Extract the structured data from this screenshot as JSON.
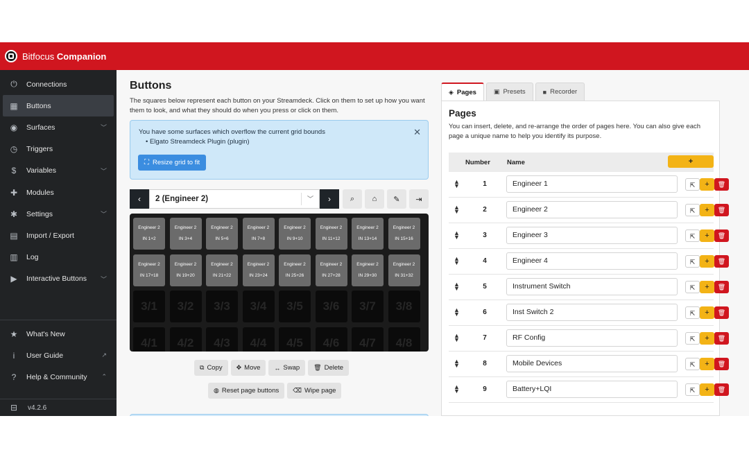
{
  "brand": {
    "name_light": "Bitfocus",
    "name_bold": "Companion"
  },
  "nav": [
    {
      "label": "Connections",
      "icon": "plug-icon",
      "glyph": "⏻",
      "chevron": false,
      "active": false
    },
    {
      "label": "Buttons",
      "icon": "grid-icon",
      "glyph": "▦",
      "chevron": false,
      "active": true
    },
    {
      "label": "Surfaces",
      "icon": "gamepad-icon",
      "glyph": "◉",
      "chevron": true,
      "active": false
    },
    {
      "label": "Triggers",
      "icon": "clock-icon",
      "glyph": "◷",
      "chevron": false,
      "active": false
    },
    {
      "label": "Variables",
      "icon": "dollar-icon",
      "glyph": "$",
      "chevron": true,
      "active": false
    },
    {
      "label": "Modules",
      "icon": "puzzle-icon",
      "glyph": "✚",
      "chevron": false,
      "active": false
    },
    {
      "label": "Settings",
      "icon": "gear-icon",
      "glyph": "✱",
      "chevron": true,
      "active": false
    },
    {
      "label": "Import / Export",
      "icon": "file-export-icon",
      "glyph": "▤",
      "chevron": false,
      "active": false
    },
    {
      "label": "Log",
      "icon": "log-icon",
      "glyph": "▥",
      "chevron": false,
      "active": false
    },
    {
      "label": "Interactive Buttons",
      "icon": "square-caret-icon",
      "glyph": "▶",
      "chevron": true,
      "active": false
    }
  ],
  "nav_bottom": [
    {
      "label": "What's New",
      "icon": "star-icon",
      "glyph": "★",
      "chevron": ""
    },
    {
      "label": "User Guide",
      "icon": "info-icon",
      "glyph": "i",
      "chevron": "↗"
    },
    {
      "label": "Help & Community",
      "icon": "question-icon",
      "glyph": "?",
      "chevron": "⌃"
    }
  ],
  "version": "v4.2.6",
  "buttons_panel": {
    "title": "Buttons",
    "description": "The squares below represent each button on your Streamdeck. Click on them to set up how you want them to look, and what they should do when you press or click on them.",
    "alert": {
      "text": "You have some surfaces which overflow the current grid bounds",
      "items": [
        "Elgato Streamdeck Plugin (plugin)"
      ],
      "button": "Resize grid to fit"
    },
    "page_select": "2 (Engineer 2)",
    "grid_labels": [
      [
        "IN 1+2",
        "IN 3+4",
        "IN 5+6",
        "IN 7+8",
        "IN 9+10",
        "IN 11+12",
        "IN 13+14",
        "IN 15+16"
      ],
      [
        "IN 17+18",
        "IN 19+20",
        "IN 21+22",
        "IN 23+24",
        "IN 25+26",
        "IN 27+28",
        "IN 29+30",
        "IN 31+32"
      ]
    ],
    "grid_title": "Engineer 2",
    "empty_rows": [
      [
        "3/1",
        "3/2",
        "3/3",
        "3/4",
        "3/5",
        "3/6",
        "3/7",
        "3/8"
      ],
      [
        "4/1",
        "4/2",
        "4/3",
        "4/4",
        "4/5",
        "4/6",
        "4/7",
        "4/8"
      ]
    ],
    "actions": {
      "copy": "Copy",
      "move": "Move",
      "swap": "Swap",
      "delete": "Delete",
      "reset": "Reset page buttons",
      "wipe": "Wipe page"
    }
  },
  "tabs": [
    {
      "label": "Pages",
      "icon": "layers-icon",
      "glyph": "◈",
      "active": true
    },
    {
      "label": "Presets",
      "icon": "gift-icon",
      "glyph": "▣",
      "active": false
    },
    {
      "label": "Recorder",
      "icon": "video-icon",
      "glyph": "■",
      "active": false
    }
  ],
  "pages_panel": {
    "title": "Pages",
    "description": "You can insert, delete, and re-arrange the order of pages here. You can also give each page a unique name to help you identify its purpose.",
    "col_number": "Number",
    "col_name": "Name",
    "add_label": "+",
    "rows": [
      {
        "number": "1",
        "name": "Engineer 1"
      },
      {
        "number": "2",
        "name": "Engineer 2"
      },
      {
        "number": "3",
        "name": "Engineer 3"
      },
      {
        "number": "4",
        "name": "Engineer 4"
      },
      {
        "number": "5",
        "name": "Instrument Switch"
      },
      {
        "number": "6",
        "name": "Inst Switch 2"
      },
      {
        "number": "7",
        "name": "RF Config"
      },
      {
        "number": "8",
        "name": "Mobile Devices"
      },
      {
        "number": "9",
        "name": "Battery+LQI"
      }
    ]
  },
  "colors": {
    "brand_red": "#d0161f",
    "sidebar": "#212325",
    "accent_yellow": "#f3b316",
    "primary_blue": "#3b8de0",
    "alert_bg": "#cfe8f9"
  }
}
